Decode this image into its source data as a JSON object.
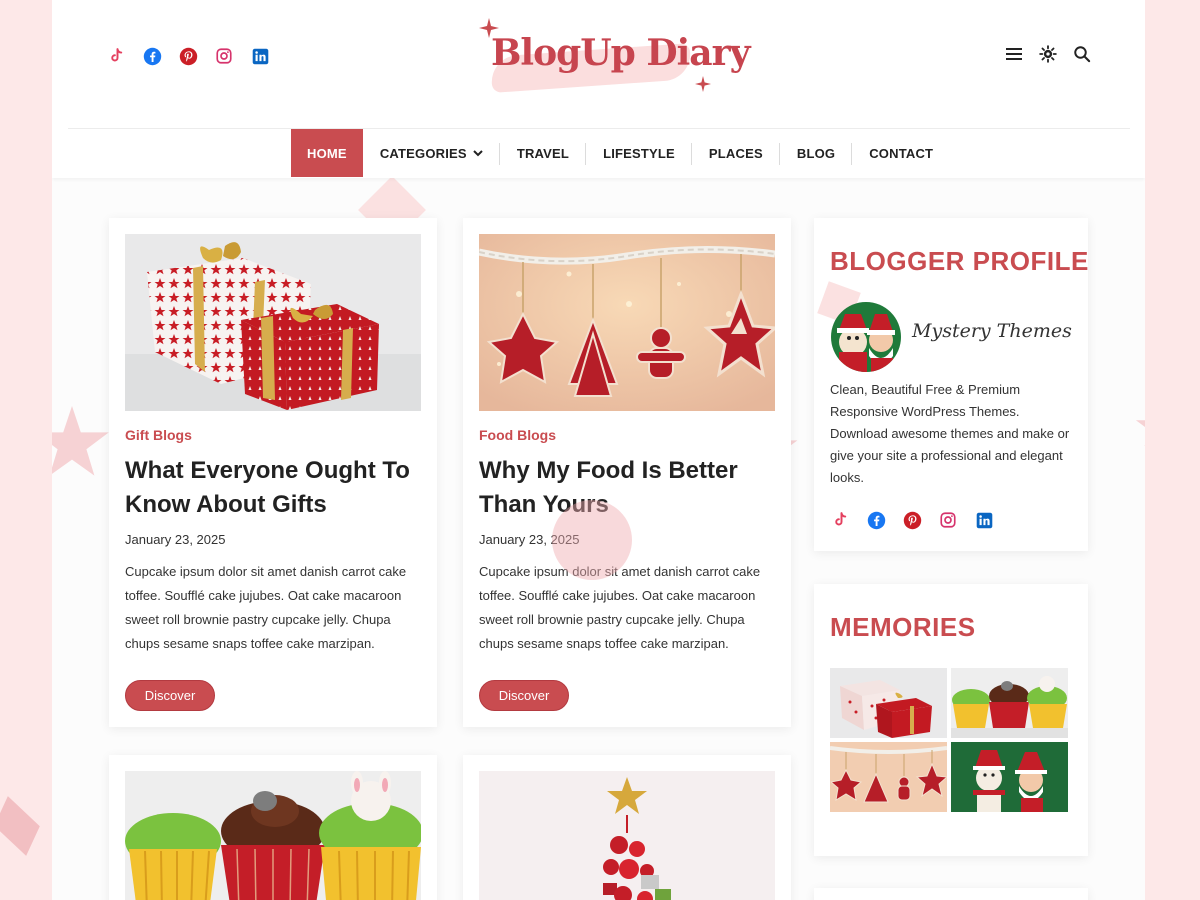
{
  "site": {
    "logo_text": "BlogUp Diary"
  },
  "header": {
    "social": [
      "tiktok-icon",
      "facebook-icon",
      "pinterest-icon",
      "instagram-icon",
      "linkedin-icon"
    ],
    "tools": [
      "menu-icon",
      "theme-toggle-icon",
      "search-icon"
    ]
  },
  "nav": {
    "items": [
      {
        "label": "HOME",
        "active": true
      },
      {
        "label": "CATEGORIES",
        "has_dropdown": true
      },
      {
        "label": "TRAVEL"
      },
      {
        "label": "LIFESTYLE"
      },
      {
        "label": "PLACES"
      },
      {
        "label": "BLOG"
      },
      {
        "label": "CONTACT"
      }
    ]
  },
  "posts": [
    {
      "image": "gift-boxes-image",
      "category": "Gift Blogs",
      "title": "What Everyone Ought To Know About Gifts",
      "date": "January 23, 2025",
      "excerpt": "Cupcake ipsum dolor sit amet danish carrot cake toffee. Soufflé cake jujubes. Oat cake macaroon sweet roll brownie pastry cupcake jelly. Chupa chups sesame snaps toffee cake marzipan.",
      "button": "Discover"
    },
    {
      "image": "gingerbread-ornaments-image",
      "category": "Food Blogs",
      "title": "Why My Food Is Better Than Yours",
      "date": "January 23, 2025",
      "excerpt": "Cupcake ipsum dolor sit amet danish carrot cake toffee. Soufflé cake jujubes. Oat cake macaroon sweet roll brownie pastry cupcake jelly. Chupa chups sesame snaps toffee cake marzipan.",
      "button": "Discover"
    },
    {
      "image": "cupcakes-image"
    },
    {
      "image": "christmas-tree-ornaments-image"
    }
  ],
  "sidebar": {
    "profile": {
      "title": "BLOGGER PROFILE",
      "name": "Mystery Themes",
      "bio": "Clean, Beautiful Free & Premium Responsive WordPress Themes. Download awesome themes and make or give your site a professional and elegant looks.",
      "social": [
        "tiktok-icon",
        "facebook-icon",
        "pinterest-icon",
        "instagram-icon",
        "linkedin-icon"
      ]
    },
    "memories": {
      "title": "MEMORIES",
      "images": [
        "gift-boxes-thumb",
        "cupcakes-thumb",
        "ornaments-thumb",
        "santa-snowman-thumb"
      ]
    }
  },
  "colors": {
    "accent": "#c94c50",
    "page_background": "#fde8e8",
    "tiktok": "#e4405f",
    "facebook": "#1877f2",
    "pinterest": "#cb1f27",
    "instagram": "#d6336c",
    "linkedin": "#0a66c2"
  }
}
